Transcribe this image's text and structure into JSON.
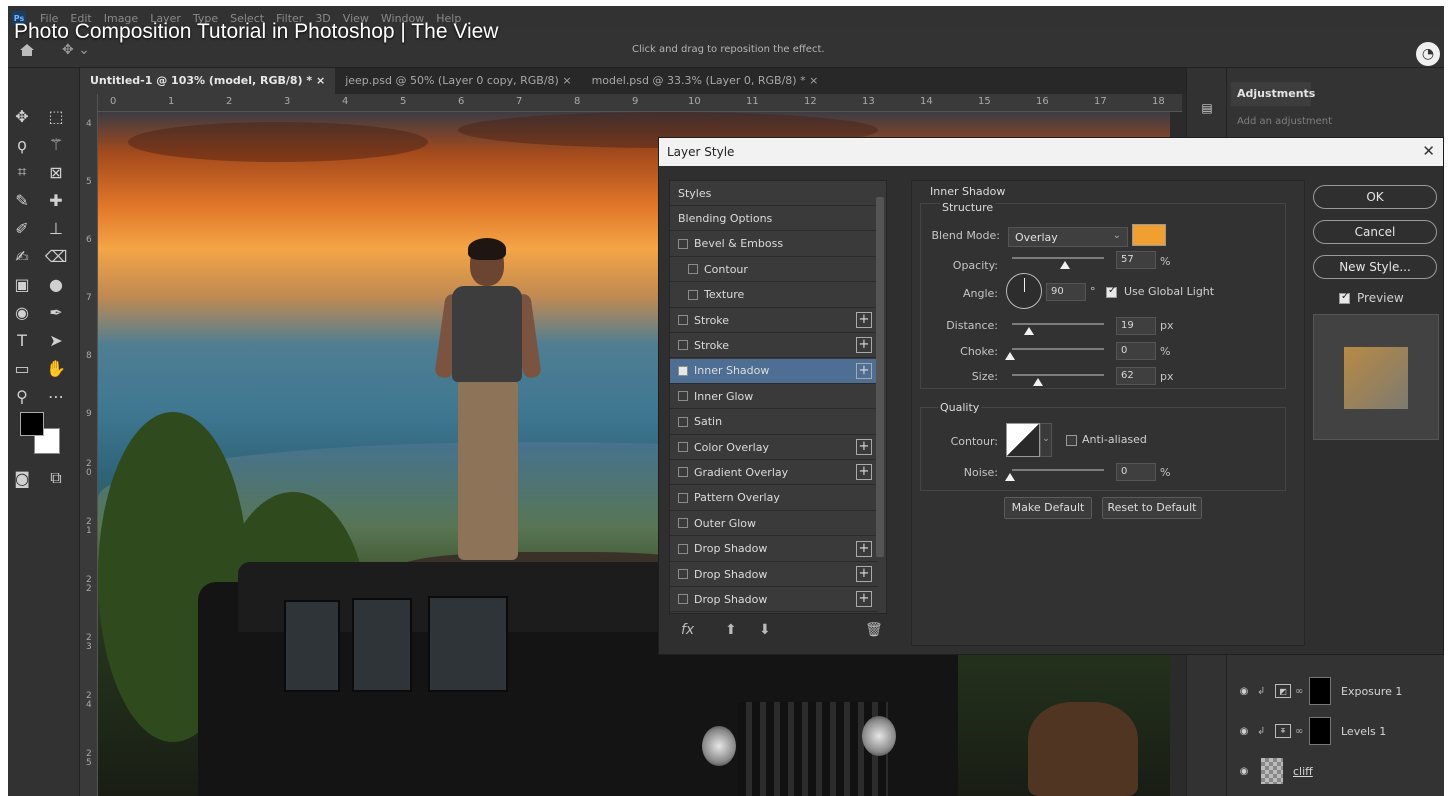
{
  "video_title": "Photo Composition Tutorial in Photoshop | The View",
  "menu": [
    "File",
    "Edit",
    "Image",
    "Layer",
    "Type",
    "Select",
    "Filter",
    "3D",
    "View",
    "Window",
    "Help"
  ],
  "options_hint": "Click and drag to reposition the effect.",
  "tabs": [
    {
      "label": "Untitled-1 @ 103% (model, RGB/8) * ×"
    },
    {
      "label": "jeep.psd @ 50% (Layer 0 copy, RGB/8) ×"
    },
    {
      "label": "model.psd @ 33.3% (Layer 0, RGB/8) * ×"
    }
  ],
  "ruler_top": [
    "0",
    "1",
    "2",
    "3",
    "4",
    "5",
    "6",
    "7",
    "8",
    "9",
    "10",
    "11",
    "12",
    "13",
    "14",
    "15",
    "16",
    "17",
    "18"
  ],
  "ruler_left": [
    "4",
    "5",
    "6",
    "7",
    "8",
    "9",
    "2\n0",
    "2\n1",
    "2\n2",
    "2\n3",
    "2\n4",
    "2\n5"
  ],
  "adjustments": {
    "tab": "Adjustments",
    "subtitle": "Add an adjustment"
  },
  "layers": [
    {
      "name": "Exposure 1"
    },
    {
      "name": "Levels 1"
    },
    {
      "name": "cliff"
    }
  ],
  "dialog": {
    "title": "Layer Style",
    "styles": [
      {
        "label": "Styles",
        "checkbox": false,
        "plus": false,
        "indent": false,
        "checked": false
      },
      {
        "label": "Blending Options",
        "checkbox": false,
        "plus": false,
        "indent": false,
        "checked": false
      },
      {
        "label": "Bevel & Emboss",
        "checkbox": true,
        "plus": false,
        "indent": false,
        "checked": false
      },
      {
        "label": "Contour",
        "checkbox": true,
        "plus": false,
        "indent": true,
        "checked": false
      },
      {
        "label": "Texture",
        "checkbox": true,
        "plus": false,
        "indent": true,
        "checked": false
      },
      {
        "label": "Stroke",
        "checkbox": true,
        "plus": true,
        "indent": false,
        "checked": false
      },
      {
        "label": "Stroke",
        "checkbox": true,
        "plus": true,
        "indent": false,
        "checked": false
      },
      {
        "label": "Inner Shadow",
        "checkbox": true,
        "plus": true,
        "indent": false,
        "checked": true,
        "selected": true
      },
      {
        "label": "Inner Glow",
        "checkbox": true,
        "plus": false,
        "indent": false,
        "checked": false
      },
      {
        "label": "Satin",
        "checkbox": true,
        "plus": false,
        "indent": false,
        "checked": false
      },
      {
        "label": "Color Overlay",
        "checkbox": true,
        "plus": true,
        "indent": false,
        "checked": false
      },
      {
        "label": "Gradient Overlay",
        "checkbox": true,
        "plus": true,
        "indent": false,
        "checked": false
      },
      {
        "label": "Pattern Overlay",
        "checkbox": true,
        "plus": false,
        "indent": false,
        "checked": false
      },
      {
        "label": "Outer Glow",
        "checkbox": true,
        "plus": false,
        "indent": false,
        "checked": false
      },
      {
        "label": "Drop Shadow",
        "checkbox": true,
        "plus": true,
        "indent": false,
        "checked": false
      },
      {
        "label": "Drop Shadow",
        "checkbox": true,
        "plus": true,
        "indent": false,
        "checked": false
      },
      {
        "label": "Drop Shadow",
        "checkbox": true,
        "plus": true,
        "indent": false,
        "checked": false
      }
    ],
    "footer_fx": "fx",
    "section_title": "Inner Shadow",
    "structure": {
      "title": "Structure",
      "blend_mode_label": "Blend Mode:",
      "blend_mode": "Overlay",
      "shadow_color": "#f0a030",
      "opacity_label": "Opacity:",
      "opacity": "57",
      "angle_label": "Angle:",
      "angle": "90",
      "degree": "°",
      "use_global_light": "Use Global Light",
      "distance_label": "Distance:",
      "distance": "19",
      "choke_label": "Choke:",
      "choke": "0",
      "size_label": "Size:",
      "size": "62",
      "px": "px",
      "pct": "%"
    },
    "quality": {
      "title": "Quality",
      "contour_label": "Contour:",
      "anti_aliased": "Anti-aliased",
      "noise_label": "Noise:",
      "noise": "0"
    },
    "make_default": "Make Default",
    "reset_default": "Reset to Default",
    "ok": "OK",
    "cancel": "Cancel",
    "new_style": "New Style...",
    "preview": "Preview"
  }
}
